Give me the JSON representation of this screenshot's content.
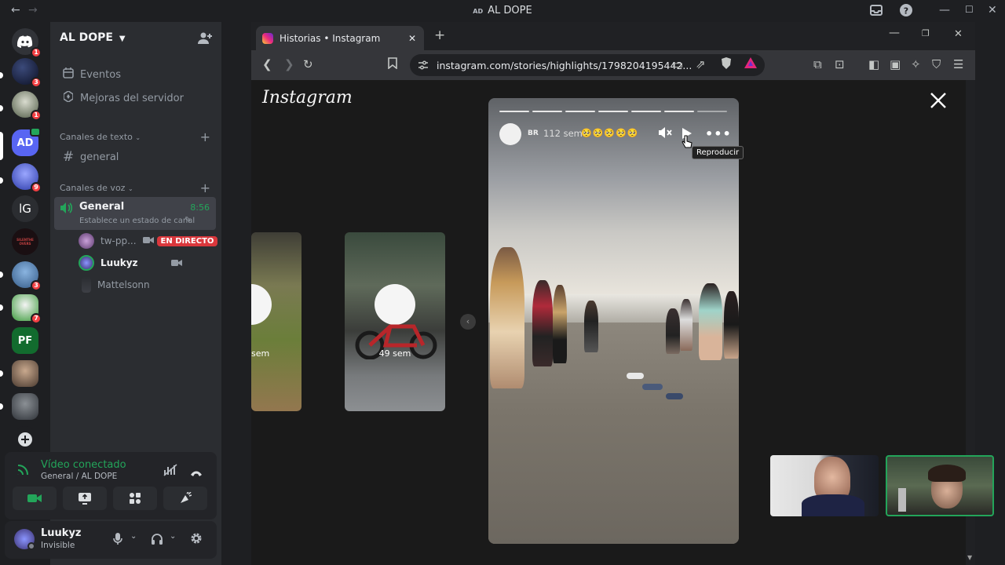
{
  "window": {
    "title_prefix": "AD",
    "title": "AL DOPE"
  },
  "rail": {
    "badges": [
      "1",
      "3",
      "1",
      "9",
      "3",
      "7"
    ],
    "ig_label": "lG",
    "pf_label": "PF",
    "ad_label": "AD",
    "lighthouse_text": "SILENTHE OVERS"
  },
  "server": {
    "name": "AL DOPE"
  },
  "sidebar": {
    "events": "Eventos",
    "boosts": "Mejoras del servidor",
    "text_category": "Canales de texto",
    "text_channel": "general",
    "voice_category": "Canales de voz",
    "voice_channel": "General",
    "voice_timer": "8:56",
    "voice_status": "Establece un estado de canal",
    "voice_users": [
      {
        "name": "tw-pp...",
        "live": "EN DIRECTO"
      },
      {
        "name": "Luukyz"
      },
      {
        "name": "Mattelsonn"
      }
    ]
  },
  "voice_panel": {
    "status": "Vídeo conectado",
    "location": "General / AL DOPE"
  },
  "user": {
    "name": "Luukyz",
    "status": "Invisible"
  },
  "browser": {
    "tab_title": "Historias • Instagram",
    "url": "instagram.com/stories/highlights/1798204195442...",
    "logo": "Instagram"
  },
  "story": {
    "username": "BR",
    "time": "112 sem",
    "emojis": "🥺🥺🥺🥺🥺",
    "tooltip": "Reproducir",
    "prev_time": "49 sem",
    "prev2_time": "sem"
  },
  "colors": {
    "accent": "#5865f2",
    "green": "#23a55a",
    "live_red": "#da373c",
    "badge_red": "#f23f43"
  }
}
